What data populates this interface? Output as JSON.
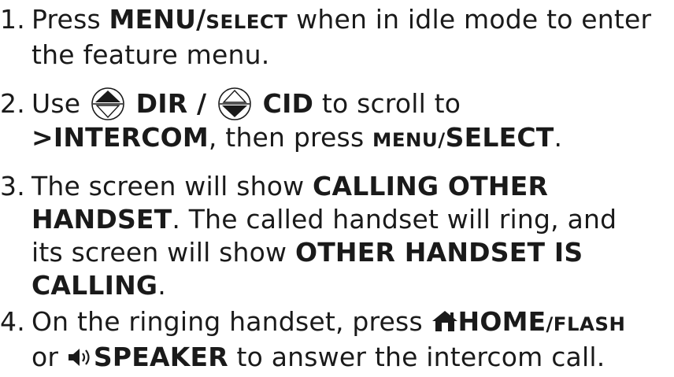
{
  "steps": [
    {
      "number": "1.",
      "parts": {
        "a": "Press ",
        "b": "MENU/",
        "c": "SELECT",
        "d": " when in idle mode to enter",
        "e": "the feature menu."
      }
    },
    {
      "number": "2.",
      "parts": {
        "a": "Use ",
        "b": " DIR / ",
        "c": " CID",
        "d": " to scroll to",
        "e": ">INTERCOM",
        "f": ", then press ",
        "g": "MENU/",
        "h": "SELECT",
        "i": "."
      }
    },
    {
      "number": "3.",
      "parts": {
        "a": "The screen will show ",
        "b": "CALLING OTHER",
        "c": "HANDSET",
        "d": ". The called handset will ring, and",
        "e": "its screen will show ",
        "f": "OTHER HANDSET IS",
        "g": "CALLING",
        "h": "."
      }
    },
    {
      "number": "4.",
      "parts": {
        "a": "On the ringing handset, press ",
        "b": "HOME",
        "c": "/FLASH",
        "d": "or ",
        "e": "SPEAKER",
        "f": " to answer the intercom call."
      }
    }
  ],
  "icons": {
    "up": "up-arrow-button-icon",
    "down": "down-arrow-button-icon",
    "home": "home-icon",
    "speaker": "speaker-icon"
  }
}
